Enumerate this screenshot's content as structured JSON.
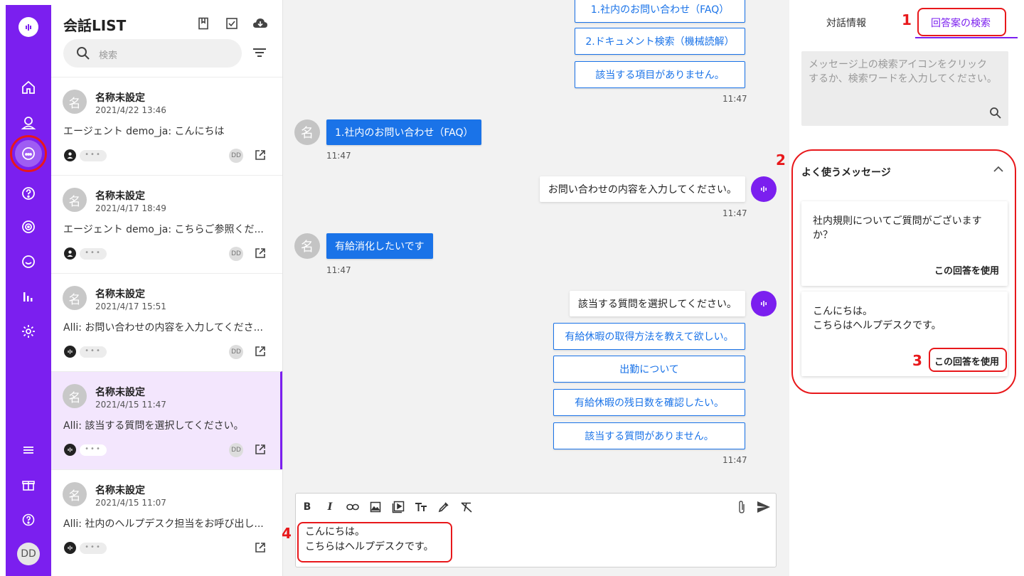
{
  "list": {
    "title": "会話LIST",
    "search_placeholder": "検索",
    "conversations": [
      {
        "avatar": "名",
        "name": "名称未設定",
        "date": "2021/4/22 13:46",
        "message": "エージェント demo_ja: こんにちは",
        "dd": "DD"
      },
      {
        "avatar": "名",
        "name": "名称未設定",
        "date": "2021/4/17 18:49",
        "message": "エージェント demo_ja: こちらご参照くだ...",
        "dd": "DD"
      },
      {
        "avatar": "名",
        "name": "名称未設定",
        "date": "2021/4/17 15:51",
        "message": "Alli: お問い合わせの内容を入力してくださ...",
        "dd": "DD"
      },
      {
        "avatar": "名",
        "name": "名称未設定",
        "date": "2021/4/15 11:47",
        "message": "Alli: 該当する質問を選択してください。",
        "dd": "DD"
      },
      {
        "avatar": "名",
        "name": "名称未設定",
        "date": "2021/4/15 11:07",
        "message": "Alli: 社内のヘルプデスク担当をお呼び出し...",
        "dd": ""
      }
    ]
  },
  "nav": {
    "avatar": "DD"
  },
  "chat": {
    "top_options": [
      "1.社内のお問い合わせ（FAQ）",
      "2.ドキュメント検索（機械読解）",
      "該当する項目がありません。"
    ],
    "t1": "11:47",
    "user_avatar": "名",
    "user_msg1": "1.社内のお問い合わせ（FAQ）",
    "t2": "11:47",
    "bot_msg1": "お問い合わせの内容を入力してください。",
    "t3": "11:47",
    "user_msg2": "有給消化したいです",
    "t4": "11:47",
    "bot_msg2": "該当する質問を選択してください。",
    "options2": [
      "有給休暇の取得方法を教えて欲しい。",
      "出勤について",
      "有給休暇の残日数を確認したい。",
      "該当する質問がありません。"
    ],
    "t5": "11:47",
    "composer_line1": "こんにちは。",
    "composer_line2": "こちらはヘルプデスクです。"
  },
  "right": {
    "tab_info": "対話情報",
    "tab_search": "回答案の検索",
    "search_placeholder": "メッセージ上の検索アイコンをクリックするか、検索ワードを入力してください。",
    "freq_title": "よく使うメッセージ",
    "cards": [
      {
        "text": "社内規則についてご質問がございますか？",
        "action": "この回答を使用"
      },
      {
        "text": "こんにちは。\nこちらはヘルプデスクです。",
        "action": "この回答を使用"
      }
    ]
  },
  "annotations": {
    "n1": "1",
    "n2": "2",
    "n3": "3",
    "n4": "4"
  },
  "colors": {
    "brand": "#7b1fef",
    "link": "#1a73e8",
    "annotation": "#e8181b",
    "selected_bg": "#f3e6fd"
  }
}
